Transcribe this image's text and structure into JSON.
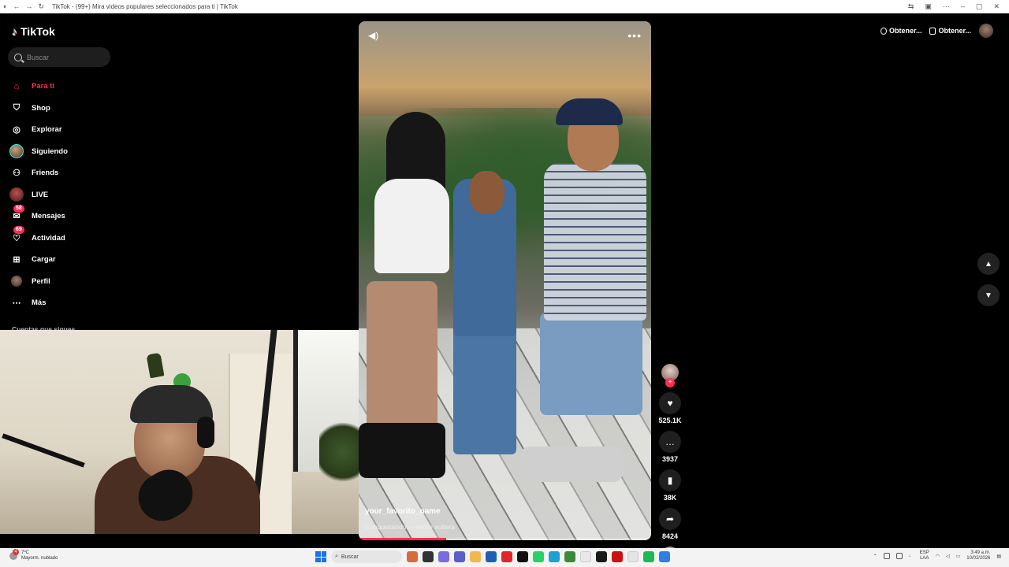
{
  "window": {
    "title": "TikTok - (99+) Mira videos populares seleccionados para ti | TikTok"
  },
  "app": {
    "logo": "TikTok",
    "search": {
      "placeholder": "Buscar"
    }
  },
  "sidebar": {
    "items": [
      {
        "label": "Para ti",
        "icon": "home-icon",
        "active": true
      },
      {
        "label": "Shop",
        "icon": "shop-bag-icon"
      },
      {
        "label": "Explorar",
        "icon": "compass-icon"
      },
      {
        "label": "Siguiendo",
        "icon": "following-avatar"
      },
      {
        "label": "Friends",
        "icon": "friends-icon"
      },
      {
        "label": "LIVE",
        "icon": "live-avatar"
      },
      {
        "label": "Mensajes",
        "icon": "messages-icon",
        "badge": "58"
      },
      {
        "label": "Actividad",
        "icon": "activity-icon",
        "badge": "69"
      },
      {
        "label": "Cargar",
        "icon": "upload-icon"
      },
      {
        "label": "Perfil",
        "icon": "profile-avatar"
      },
      {
        "label": "Más",
        "icon": "more-dots-icon"
      }
    ],
    "following_title": "Cuentas que sigues"
  },
  "video": {
    "author": "your_favorito_name",
    "caption": "Conquistando a madre soltera",
    "progress": 0.3
  },
  "actions": {
    "likes": "525.1K",
    "comments": "3937",
    "saves": "38K",
    "shares": "8424"
  },
  "topbar": {
    "get_app_1": "Obtener...",
    "get_app_2": "Obtener..."
  },
  "taskbar": {
    "weather_temp": "7ºC",
    "weather_desc": "Mayorm. nublado",
    "notif_count": "4",
    "search_placeholder": "Buscar",
    "lang_1": "ESP",
    "lang_2": "LAA",
    "time": "3:49 a.m.",
    "date": "10/02/2026"
  },
  "colors": {
    "accent": "#fe2c55",
    "cyan": "#25f4ee",
    "background": "#000000"
  }
}
